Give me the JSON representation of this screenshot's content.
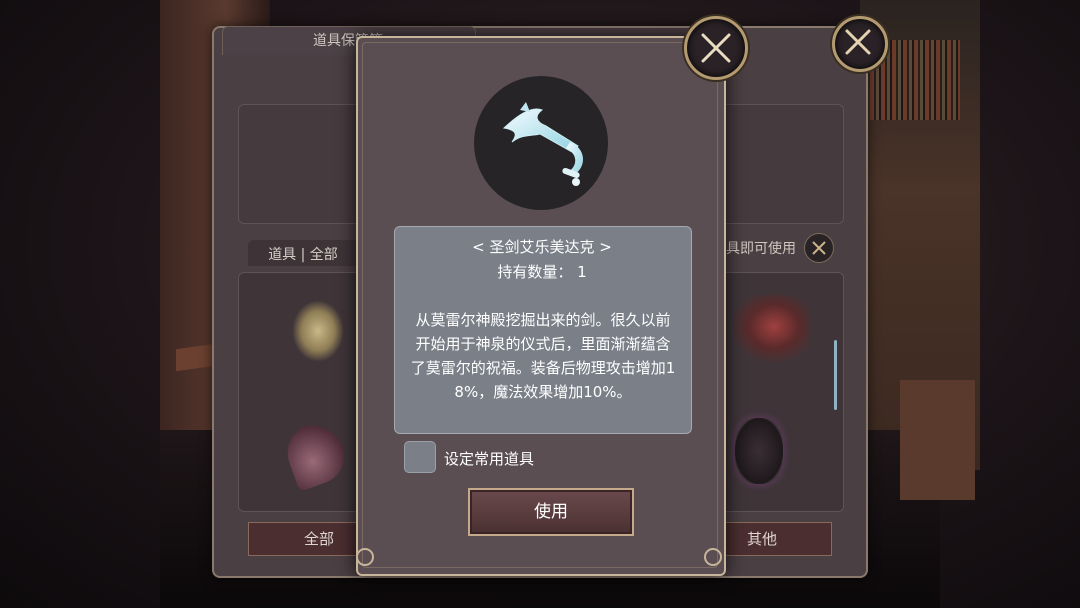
{
  "inventory": {
    "title": "道具保管箱",
    "filter_label": "道具 | 全部",
    "hint": "具即可使用",
    "buttons": {
      "all": "全部",
      "other": "其他"
    }
  },
  "dialog": {
    "item_name": "< 圣剑艾乐美达克 >",
    "quantity": "持有数量： 1",
    "description": "从莫雷尔神殿挖掘出来的剑。很久以前开始用于神泉的仪式后，里面渐渐蕴含了莫雷尔的祝福。装备后物理攻击增加18%，魔法效果增加10%。",
    "checkbox_label": "设定常用道具",
    "use_button": "使用"
  },
  "colors": {
    "accent_border": "#c8b69a",
    "desc_box": "#7b7f88",
    "dialog_bg": "#5a4e52"
  }
}
